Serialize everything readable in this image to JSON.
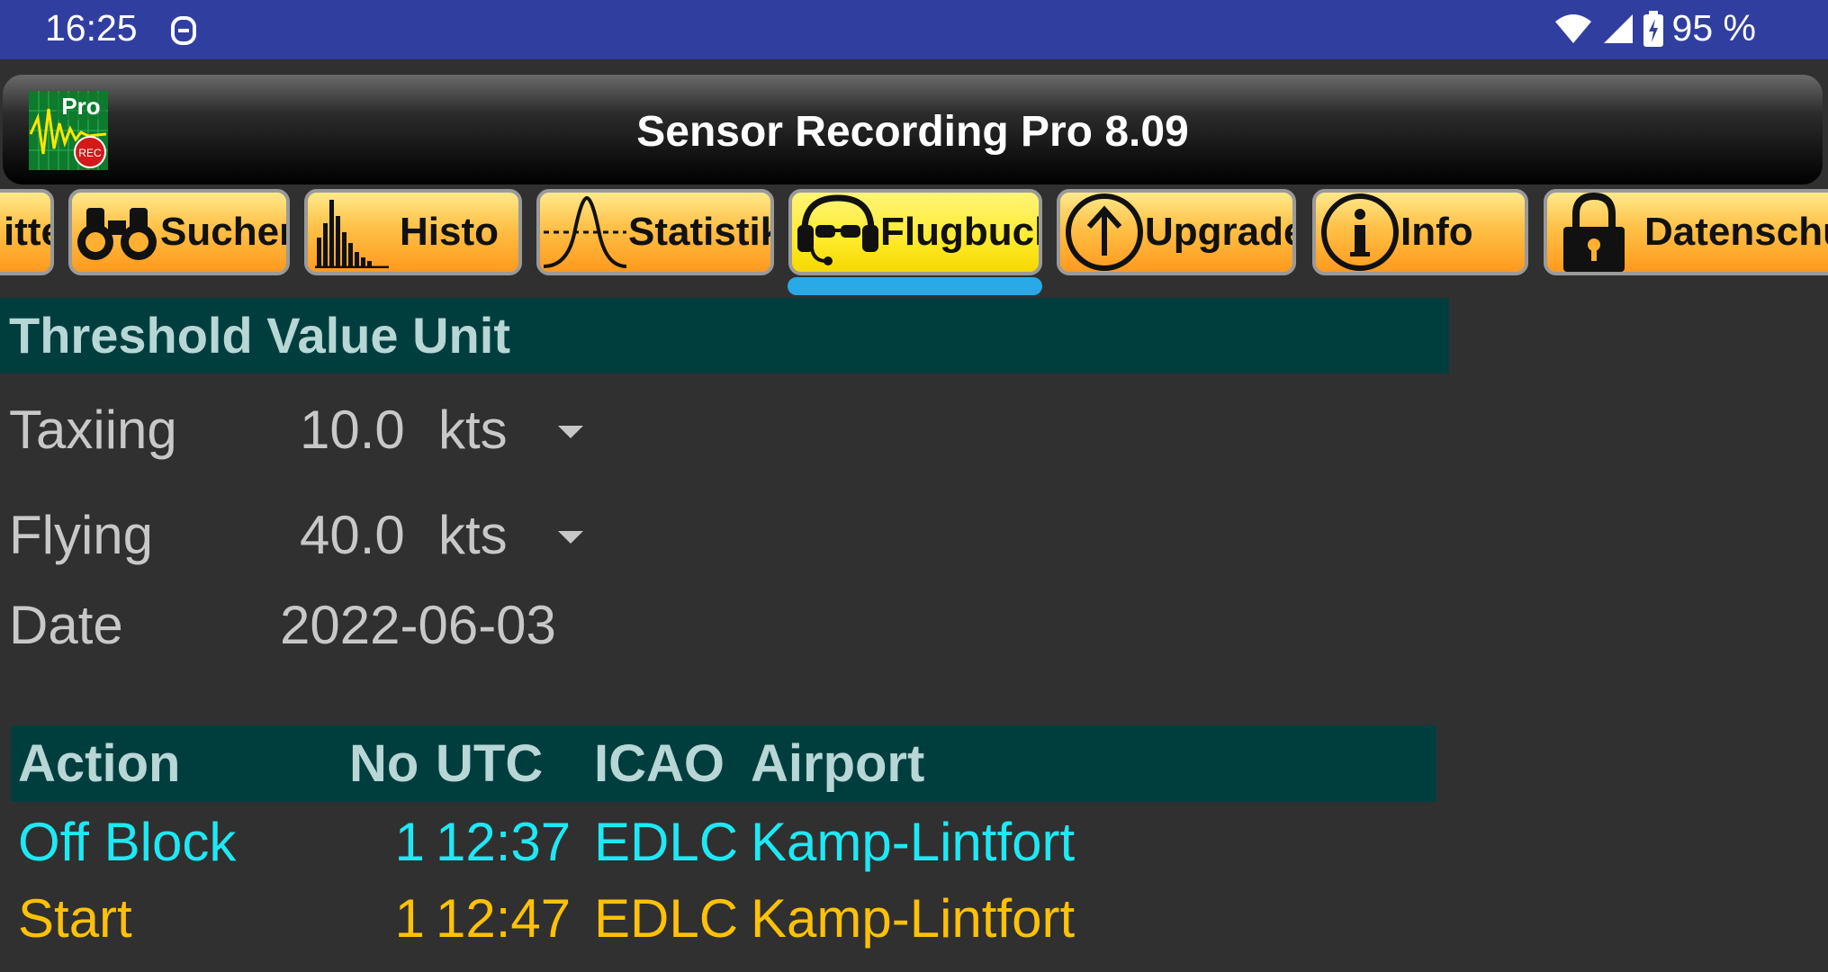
{
  "status_bar": {
    "time": "16:25",
    "battery": "95 %"
  },
  "app": {
    "title": "Sensor Recording Pro 8.09",
    "icon_badge": "Pro",
    "icon_rec": "REC"
  },
  "tabs": [
    {
      "label": "itte",
      "icon": "none"
    },
    {
      "label": "Suchen",
      "icon": "binoculars-icon"
    },
    {
      "label": "Histo",
      "icon": "histogram-icon"
    },
    {
      "label": "Statistik",
      "icon": "bell-curve-icon"
    },
    {
      "label": "Flugbuch",
      "icon": "pilot-headset-icon",
      "active": true
    },
    {
      "label": "Upgrade",
      "icon": "arrow-up-circle-icon"
    },
    {
      "label": "Info",
      "icon": "info-circle-icon"
    },
    {
      "label": "Datenschu",
      "icon": "lock-icon"
    }
  ],
  "threshold": {
    "header": "Threshold Value Unit",
    "taxiing": {
      "label": "Taxiing",
      "value": "10.0",
      "unit": "kts"
    },
    "flying": {
      "label": "Flying",
      "value": "40.0",
      "unit": "kts"
    },
    "date": {
      "label": "Date",
      "value": "2022-06-03"
    }
  },
  "log": {
    "columns": {
      "action": "Action",
      "no": "No",
      "utc": "UTC",
      "icao": "ICAO",
      "airport": "Airport"
    },
    "rows": [
      {
        "action": "Off Block",
        "no": "1",
        "utc": "12:37",
        "icao": "EDLC",
        "airport": "Kamp-Lintfort",
        "color": "#1de9f5"
      },
      {
        "action": "Start",
        "no": "1",
        "utc": "12:47",
        "icao": "EDLC",
        "airport": "Kamp-Lintfort",
        "color": "#ffc107"
      }
    ]
  },
  "colors": {
    "status_bar": "#303f9f",
    "background": "#303030",
    "header_bg": "#003e3e",
    "tab_indicator": "#29a9e6"
  }
}
